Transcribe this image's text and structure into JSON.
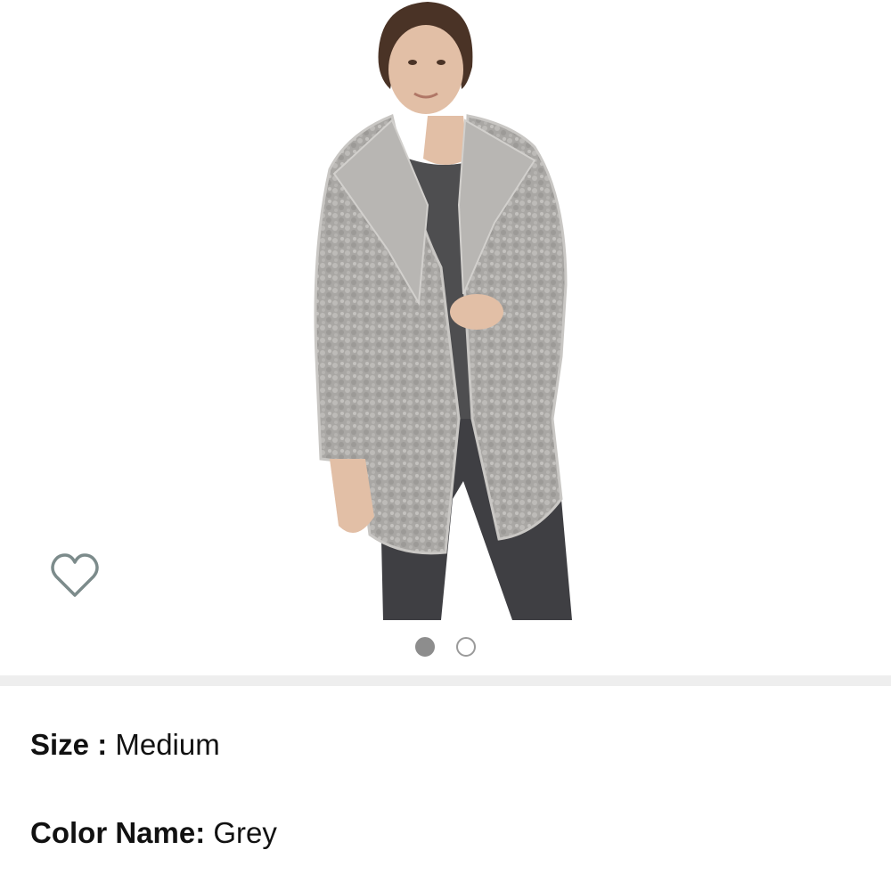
{
  "product": {
    "image_alt": "Grey faux fur teddy coat worn by model",
    "wishlist_icon": "heart-outline-icon",
    "carousel": {
      "total": 2,
      "active_index": 0
    }
  },
  "details": {
    "size_label": "Size :",
    "size_value": "Medium",
    "color_label": "Color Name:",
    "color_value": "Grey"
  },
  "colors": {
    "coat": "#a9a7a4",
    "sweater": "#4e4e50",
    "pants": "#3f3f43",
    "skin": "#e2bfa6",
    "hair": "#4a3326",
    "heart_stroke": "#7c8b8b",
    "divider": "#eeeeee"
  }
}
